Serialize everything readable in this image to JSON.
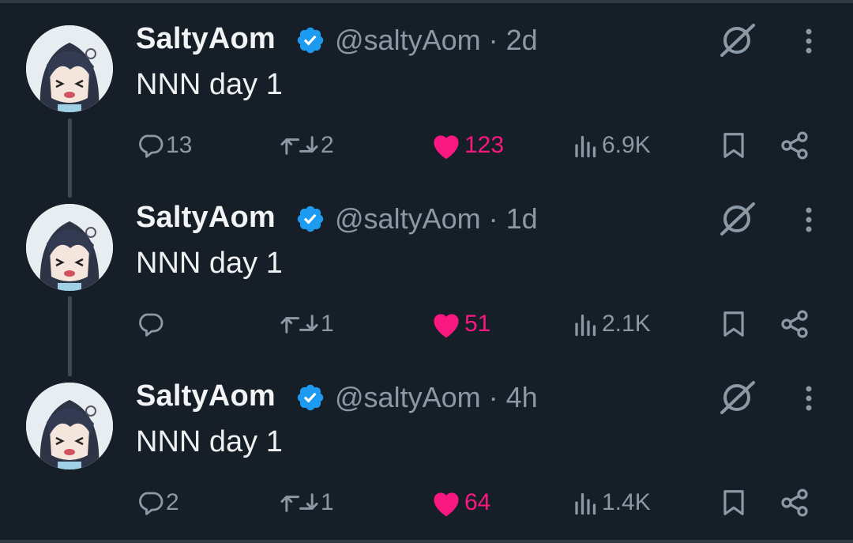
{
  "tweets": [
    {
      "name": "SaltyAom",
      "handle": "@saltyAom",
      "time": "2d",
      "text": "NNN day 1",
      "replies": "13",
      "retweets": "2",
      "likes": "123",
      "views": "6.9K"
    },
    {
      "name": "SaltyAom",
      "handle": "@saltyAom",
      "time": "1d",
      "text": "NNN day 1",
      "replies": "",
      "retweets": "1",
      "likes": "51",
      "views": "2.1K"
    },
    {
      "name": "SaltyAom",
      "handle": "@saltyAom",
      "time": "4h",
      "text": "NNN day 1",
      "replies": "2",
      "retweets": "1",
      "likes": "64",
      "views": "1.4K"
    }
  ],
  "meta_separator": " · ",
  "colors": {
    "background": "#161e27",
    "like": "#f91880",
    "verified": "#1d9bf0",
    "muted": "#8b98a5"
  },
  "icons": [
    "verified-badge-icon",
    "grok-icon",
    "more-icon",
    "reply-icon",
    "retweet-icon",
    "heart-icon",
    "views-icon",
    "bookmark-icon",
    "share-icon"
  ]
}
